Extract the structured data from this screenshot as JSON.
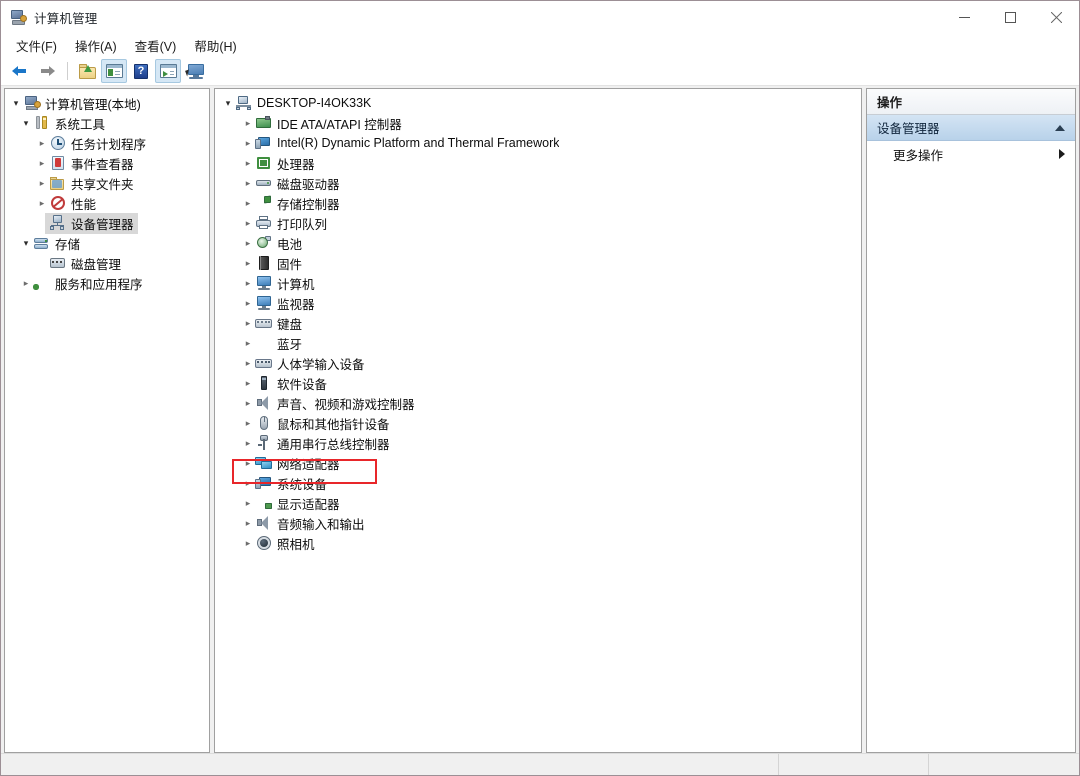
{
  "window": {
    "title": "计算机管理",
    "icon": "computer-management-icon",
    "controls": {
      "minimize": "最小化",
      "maximize": "最大化",
      "close": "关闭"
    }
  },
  "menubar": {
    "items": [
      {
        "label": "文件(F)",
        "name": "menu-file"
      },
      {
        "label": "操作(A)",
        "name": "menu-action"
      },
      {
        "label": "查看(V)",
        "name": "menu-view"
      },
      {
        "label": "帮助(H)",
        "name": "menu-help"
      }
    ]
  },
  "toolbar": {
    "buttons": [
      {
        "name": "back-button",
        "icon": "back-arrow-icon",
        "title": "后退"
      },
      {
        "name": "forward-button",
        "icon": "forward-arrow-icon",
        "title": "前进"
      },
      {
        "name": "up-one-level-button",
        "icon": "folder-up-icon",
        "title": "上一级"
      },
      {
        "name": "show-hide-tree-button",
        "icon": "console-tree-icon",
        "title": "显示/隐藏控制台树"
      },
      {
        "name": "help-button",
        "icon": "help-icon",
        "title": "帮助"
      },
      {
        "name": "show-action-pane-button",
        "icon": "action-pane-icon",
        "title": "显示/隐藏操作窗格"
      },
      {
        "name": "remote-computer-button",
        "icon": "monitor-icon",
        "title": "连接到另一台计算机"
      }
    ]
  },
  "console_tree": {
    "items": [
      {
        "label": "计算机管理(本地)",
        "icon": "computer-management-icon",
        "indent": 0,
        "chevron": "open",
        "selected": false
      },
      {
        "label": "系统工具",
        "icon": "system-tools-icon",
        "indent": 1,
        "chevron": "open",
        "selected": false
      },
      {
        "label": "任务计划程序",
        "icon": "task-scheduler-icon",
        "indent": 2,
        "chevron": "closed",
        "selected": false
      },
      {
        "label": "事件查看器",
        "icon": "event-viewer-icon",
        "indent": 2,
        "chevron": "closed",
        "selected": false
      },
      {
        "label": "共享文件夹",
        "icon": "shared-folders-icon",
        "indent": 2,
        "chevron": "closed",
        "selected": false
      },
      {
        "label": "性能",
        "icon": "performance-icon",
        "indent": 2,
        "chevron": "closed",
        "selected": false
      },
      {
        "label": "设备管理器",
        "icon": "device-manager-icon",
        "indent": 2,
        "chevron": "none",
        "selected": true
      },
      {
        "label": "存储",
        "icon": "storage-icon",
        "indent": 1,
        "chevron": "open",
        "selected": false
      },
      {
        "label": "磁盘管理",
        "icon": "disk-management-icon",
        "indent": 2,
        "chevron": "none",
        "selected": false
      },
      {
        "label": "服务和应用程序",
        "icon": "services-applications-icon",
        "indent": 1,
        "chevron": "closed",
        "selected": false
      }
    ]
  },
  "device_tree": {
    "root": {
      "label": "DESKTOP-I4OK33K",
      "icon": "computer-node-icon",
      "chevron": "open"
    },
    "items": [
      {
        "label": "IDE ATA/ATAPI 控制器",
        "icon": "ide-controller-icon",
        "highlighted": false
      },
      {
        "label": "Intel(R) Dynamic Platform and Thermal Framework",
        "icon": "intel-framework-icon",
        "highlighted": false
      },
      {
        "label": "处理器",
        "icon": "processor-icon",
        "highlighted": false
      },
      {
        "label": "磁盘驱动器",
        "icon": "disk-drive-icon",
        "highlighted": false
      },
      {
        "label": "存储控制器",
        "icon": "storage-controller-icon",
        "highlighted": false
      },
      {
        "label": "打印队列",
        "icon": "print-queue-icon",
        "highlighted": false
      },
      {
        "label": "电池",
        "icon": "battery-icon",
        "highlighted": false
      },
      {
        "label": "固件",
        "icon": "firmware-icon",
        "highlighted": false
      },
      {
        "label": "计算机",
        "icon": "computer-icon",
        "highlighted": false
      },
      {
        "label": "监视器",
        "icon": "monitor-device-icon",
        "highlighted": false
      },
      {
        "label": "键盘",
        "icon": "keyboard-icon",
        "highlighted": false
      },
      {
        "label": "蓝牙",
        "icon": "bluetooth-icon",
        "highlighted": false
      },
      {
        "label": "人体学输入设备",
        "icon": "hid-icon",
        "highlighted": false
      },
      {
        "label": "软件设备",
        "icon": "software-device-icon",
        "highlighted": false
      },
      {
        "label": "声音、视频和游戏控制器",
        "icon": "sound-video-game-icon",
        "highlighted": false
      },
      {
        "label": "鼠标和其他指针设备",
        "icon": "mouse-icon",
        "highlighted": false
      },
      {
        "label": "通用串行总线控制器",
        "icon": "usb-controller-icon",
        "highlighted": false
      },
      {
        "label": "网络适配器",
        "icon": "network-adapter-icon",
        "highlighted": false
      },
      {
        "label": "系统设备",
        "icon": "system-devices-icon",
        "highlighted": true
      },
      {
        "label": "显示适配器",
        "icon": "display-adapter-icon",
        "highlighted": false
      },
      {
        "label": "音频输入和输出",
        "icon": "audio-io-icon",
        "highlighted": false
      },
      {
        "label": "照相机",
        "icon": "camera-icon",
        "highlighted": false
      }
    ]
  },
  "actions_pane": {
    "header": "操作",
    "section": {
      "label": "设备管理器",
      "caret": "caret-up-icon"
    },
    "items": [
      {
        "label": "更多操作",
        "caret": "caret-right-icon"
      }
    ]
  },
  "statusbar": {
    "left": "",
    "middle": "",
    "right": ""
  },
  "annotation": {
    "target": "系统设备",
    "color": "#e8262a"
  }
}
